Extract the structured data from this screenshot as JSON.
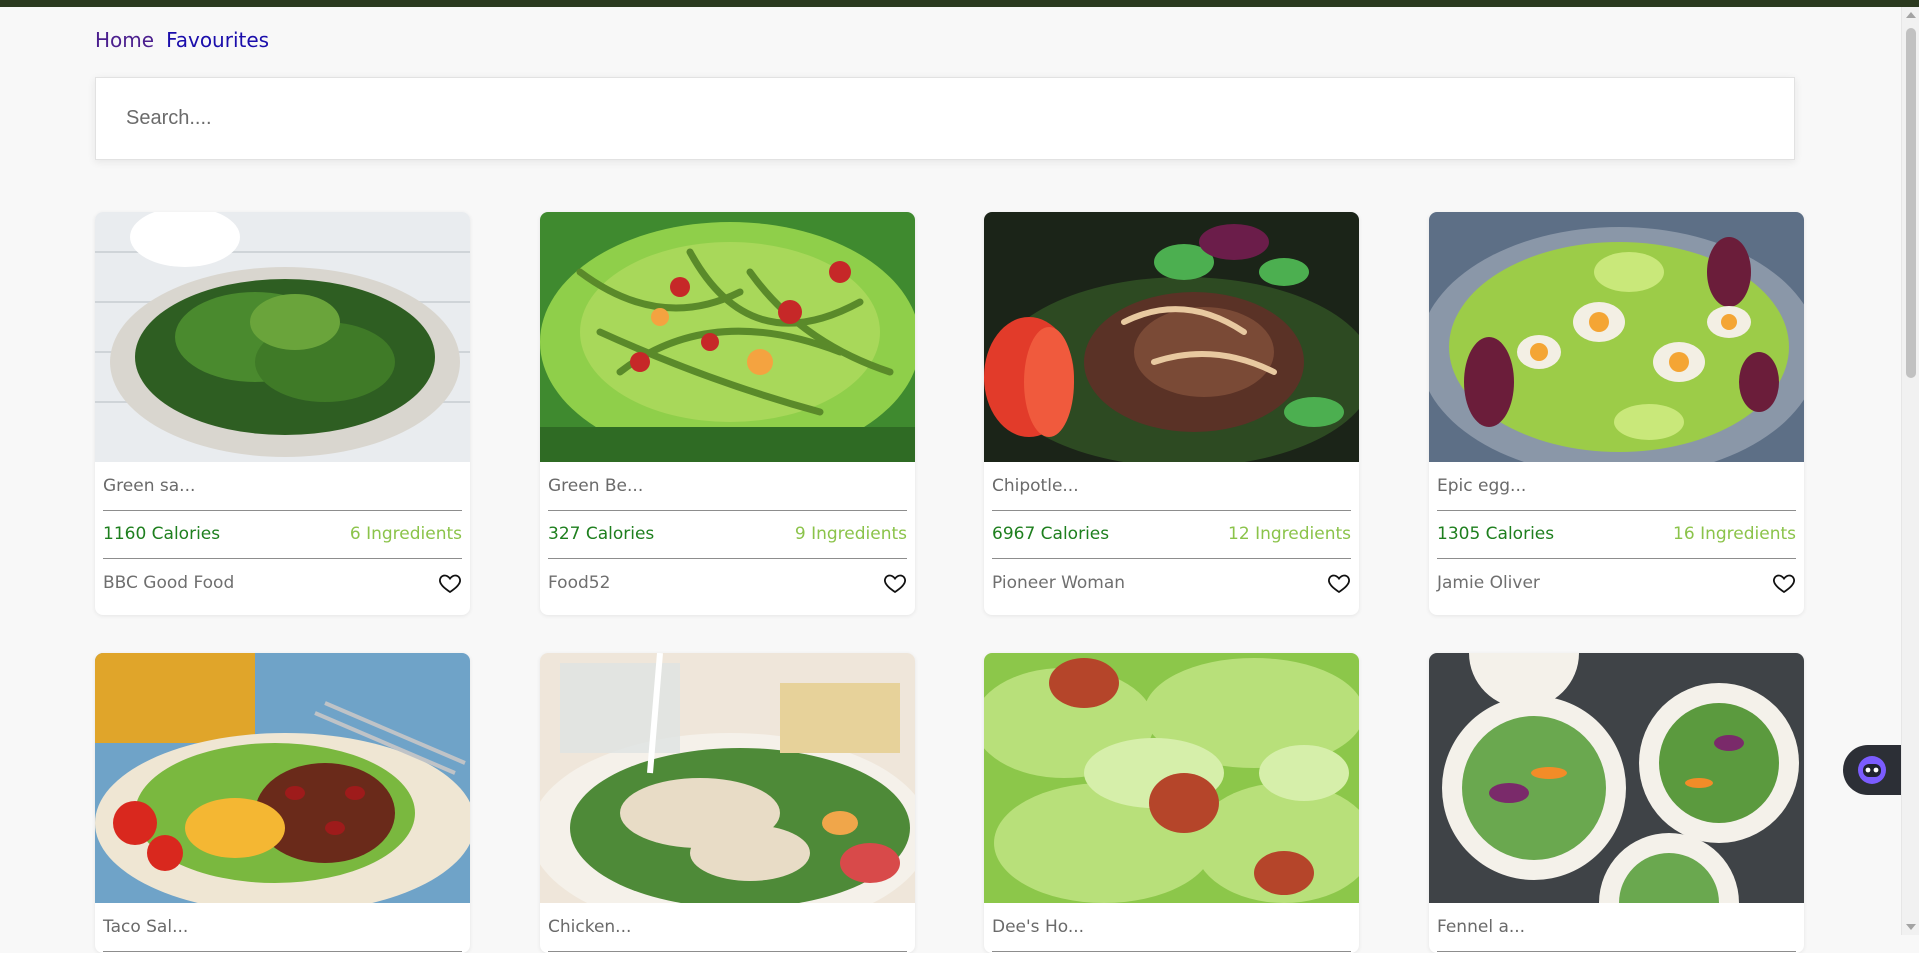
{
  "nav": {
    "home_label": "Home",
    "favourites_label": "Favourites"
  },
  "search": {
    "placeholder": "Search....",
    "value": ""
  },
  "recipes": [
    {
      "title": "Green sa...",
      "calories": "1160 Calories",
      "ingredients": "6 Ingredients",
      "source": "BBC Good Food"
    },
    {
      "title": "Green Be...",
      "calories": "327 Calories",
      "ingredients": "9 Ingredients",
      "source": "Food52"
    },
    {
      "title": "Chipotle...",
      "calories": "6967 Calories",
      "ingredients": "12 Ingredients",
      "source": "Pioneer Woman"
    },
    {
      "title": "Epic egg...",
      "calories": "1305 Calories",
      "ingredients": "16 Ingredients",
      "source": "Jamie Oliver"
    },
    {
      "title": "Taco Sal..."
    },
    {
      "title": "Chicken..."
    },
    {
      "title": "Dee's Ho..."
    },
    {
      "title": "Fennel a..."
    }
  ],
  "icons": {
    "favourite": "heart-outline-icon",
    "assistant": "robot-assistant-icon"
  },
  "colors": {
    "calories": "#1e7f1e",
    "ingredients": "#8bc34a",
    "top_bar": "#2b3a1f",
    "nav_link": "#1a0dab"
  }
}
